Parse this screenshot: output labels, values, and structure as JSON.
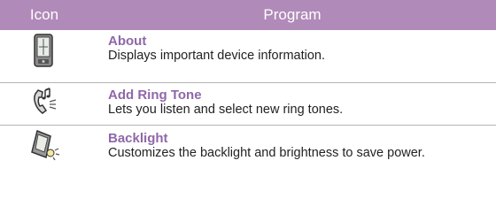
{
  "table": {
    "headers": {
      "icon": "Icon",
      "program": "Program"
    },
    "rows": [
      {
        "icon": "pda-device-icon",
        "title": "About",
        "description": "Displays important device information."
      },
      {
        "icon": "ring-tone-phone-icon",
        "title": "Add Ring Tone",
        "description": "Lets you listen and select new ring tones."
      },
      {
        "icon": "backlight-device-icon",
        "title": "Backlight",
        "description": "Customizes the backlight and brightness to save power."
      }
    ]
  },
  "colors": {
    "header_bg": "#b08ab8",
    "title": "#8f67a8",
    "divider": "#b5b5b5"
  }
}
